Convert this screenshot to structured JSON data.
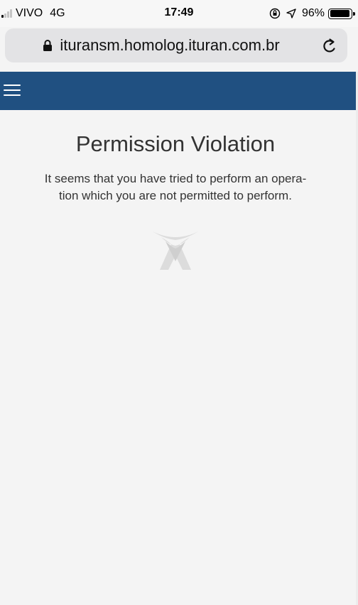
{
  "status_bar": {
    "carrier": "VIVO",
    "network": "4G",
    "time": "17:49",
    "battery": "96%",
    "battery_level": 0.96
  },
  "browser": {
    "url": "ituransm.homolog.ituran.com.br"
  },
  "colors": {
    "navbar": "#205081",
    "background": "#f4f4f4",
    "text": "#333333"
  },
  "error": {
    "title": "Permission Violation",
    "message_line1": "It seems that you have tried to perform an opera-",
    "message_line2": "tion which you are not permitted to perform."
  }
}
